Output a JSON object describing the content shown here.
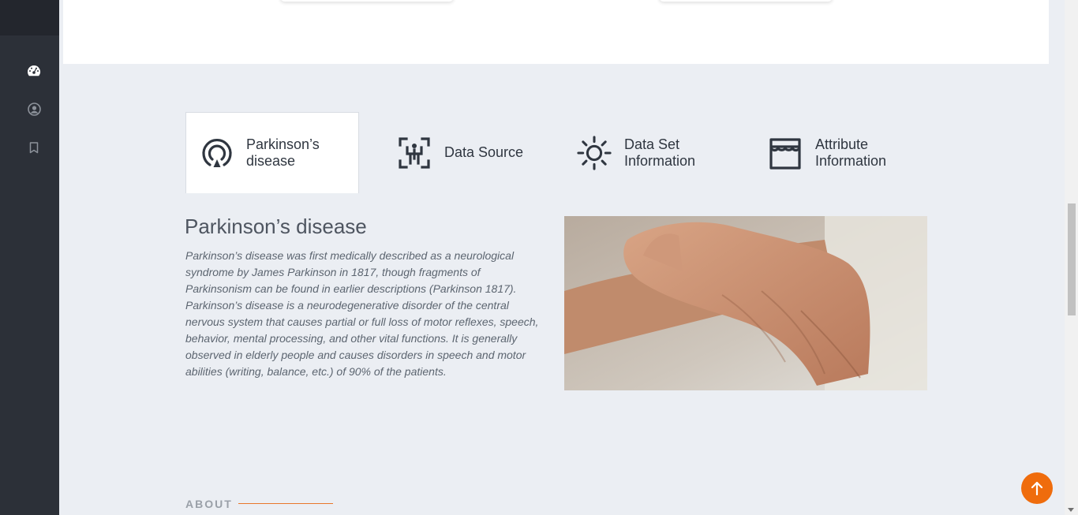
{
  "tabs": [
    {
      "label": "Parkinson’s disease",
      "icon": "parkinson-icon",
      "active": true
    },
    {
      "label": "Data Source",
      "icon": "data-source-icon",
      "active": false
    },
    {
      "label": "Data Set Information",
      "icon": "dataset-info-icon",
      "active": false
    },
    {
      "label": "Attribute Information",
      "icon": "attribute-store-icon",
      "active": false
    }
  ],
  "content": {
    "title": "Parkinson’s disease",
    "body": "Parkinson’s disease was first medically described as a neurological syndrome by James Parkinson in 1817, though fragments of Parkinsonism can be found in earlier descriptions (Parkinson 1817). Parkinson’s disease is a neurodegenerative disorder of the central nervous system that causes partial or full loss of motor reflexes, speech, behavior, mental processing, and other vital functions. It is generally observed in elderly people and causes disorders in speech and motor abilities (writing, balance, etc.) of 90% of the patients."
  },
  "about": {
    "label": "ABOUT"
  },
  "sidebar": {
    "icons": [
      "dashboard-icon",
      "user-icon",
      "bookmark-icon"
    ]
  },
  "colors": {
    "sidebar": "#2c3038",
    "accent": "#ef6c0c",
    "background": "#ebeef3"
  }
}
